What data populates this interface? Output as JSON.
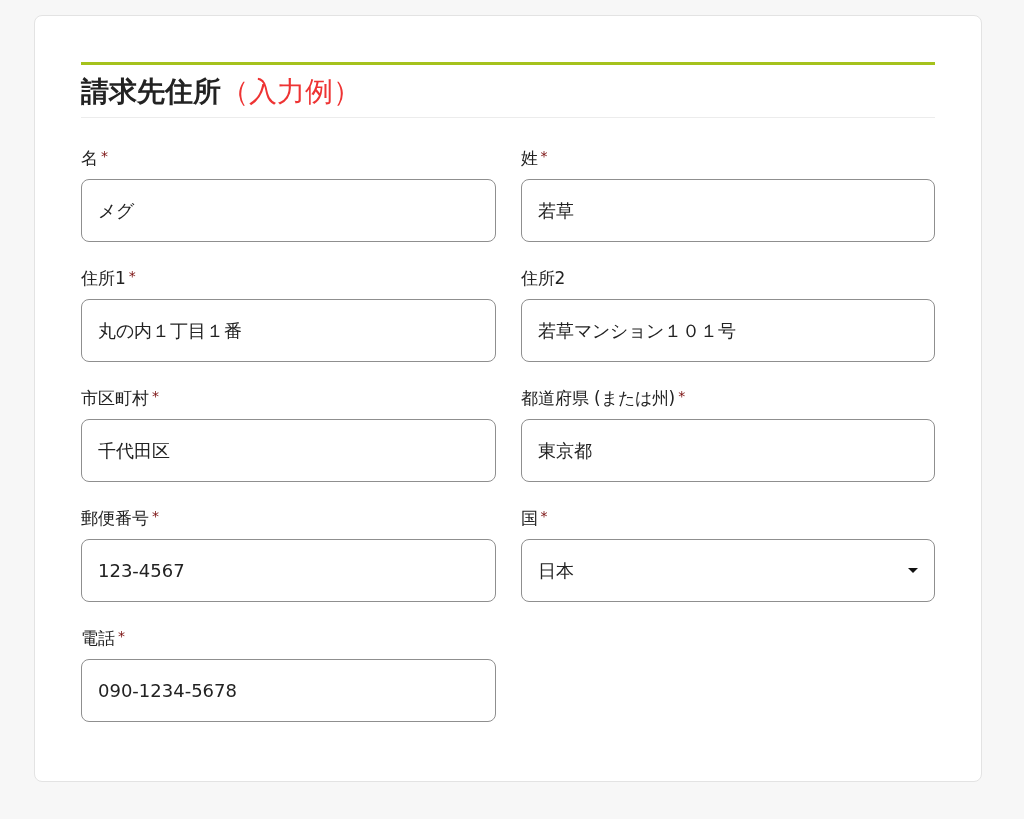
{
  "heading": {
    "title": "請求先住所",
    "note": "（入力例）"
  },
  "fields": [
    {
      "label": "名",
      "required_mark": "*",
      "kind": "text",
      "value": "メグ"
    },
    {
      "label": "姓",
      "required_mark": "*",
      "kind": "text",
      "value": "若草"
    },
    {
      "label": "住所1",
      "required_mark": "*",
      "kind": "text",
      "value": "丸の内１丁目１番"
    },
    {
      "label": "住所2",
      "kind": "text",
      "value": "若草マンション１０１号"
    },
    {
      "label": "市区町村",
      "required_mark": "*",
      "kind": "text",
      "value": "千代田区"
    },
    {
      "label": "都道府県 (または州)",
      "required_mark": "*",
      "kind": "text",
      "value": "東京都"
    },
    {
      "label": "郵便番号",
      "required_mark": "*",
      "kind": "text",
      "value": "123-4567"
    },
    {
      "label": "国",
      "required_mark": "*",
      "kind": "select",
      "value": "日本"
    },
    {
      "label": "電話",
      "required_mark": "*",
      "kind": "text",
      "value": "090-1234-5678"
    }
  ]
}
